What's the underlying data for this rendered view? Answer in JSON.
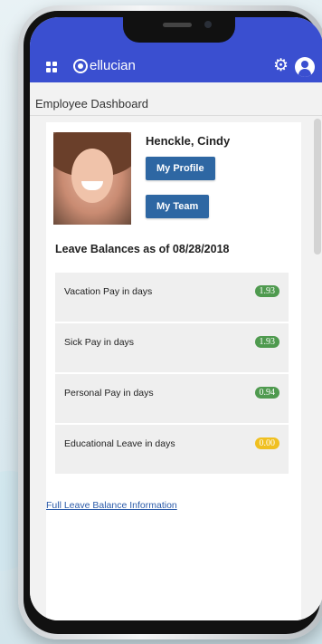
{
  "header": {
    "brand": "ellucian",
    "brand_icon": "ellucian-logo-icon",
    "menu_icon": "app-grid-icon",
    "settings_icon": "gear-icon",
    "user_icon": "user-icon",
    "color": "#3a4fd0"
  },
  "page": {
    "breadcrumb": "Employee Dashboard"
  },
  "profile": {
    "name": "Henckle, Cindy",
    "my_profile_label": "My Profile",
    "my_team_label": "My Team",
    "button_color": "#2e67a3"
  },
  "leave": {
    "title": "Leave Balances as of 08/28/2018",
    "rows": [
      {
        "label": "Vacation Pay in days",
        "value": "1.93",
        "color": "#4f9a4f"
      },
      {
        "label": "Sick Pay in days",
        "value": "1.93",
        "color": "#4f9a4f"
      },
      {
        "label": "Personal Pay in days",
        "value": "0.94",
        "color": "#4f9a4f"
      },
      {
        "label": "Educational Leave in days",
        "value": "0.00",
        "color": "#f0c020"
      }
    ],
    "link": "Full Leave Balance Information"
  }
}
